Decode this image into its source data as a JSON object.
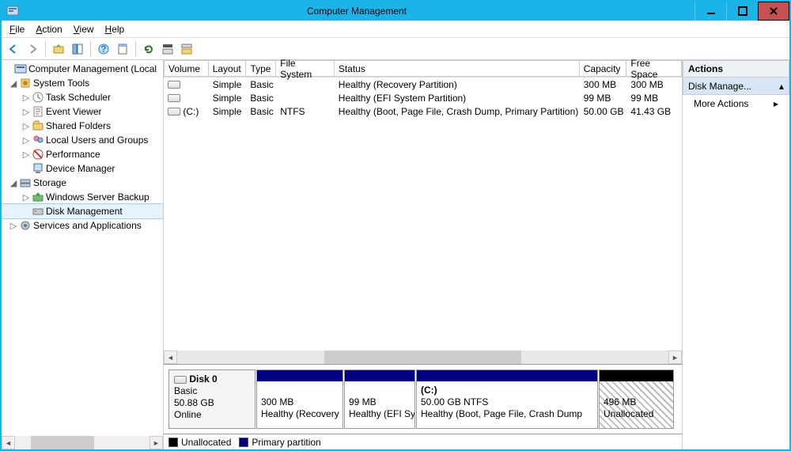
{
  "window": {
    "title": "Computer Management"
  },
  "menu": {
    "file": "File",
    "action": "Action",
    "view": "View",
    "help": "Help"
  },
  "tree": {
    "root": "Computer Management (Local",
    "systools": "System Tools",
    "tasksched": "Task Scheduler",
    "eventviewer": "Event Viewer",
    "sharedfolders": "Shared Folders",
    "localusers": "Local Users and Groups",
    "performance": "Performance",
    "devicemgr": "Device Manager",
    "storage": "Storage",
    "wsb": "Windows Server Backup",
    "diskmgmt": "Disk Management",
    "services": "Services and Applications"
  },
  "grid": {
    "headers": {
      "volume": "Volume",
      "layout": "Layout",
      "type": "Type",
      "fs": "File System",
      "status": "Status",
      "capacity": "Capacity",
      "free": "Free Space"
    },
    "rows": [
      {
        "vol": "",
        "layout": "Simple",
        "type": "Basic",
        "fs": "",
        "status": "Healthy (Recovery Partition)",
        "cap": "300 MB",
        "free": "300 MB"
      },
      {
        "vol": "",
        "layout": "Simple",
        "type": "Basic",
        "fs": "",
        "status": "Healthy (EFI System Partition)",
        "cap": "99 MB",
        "free": "99 MB"
      },
      {
        "vol": "(C:)",
        "layout": "Simple",
        "type": "Basic",
        "fs": "NTFS",
        "status": "Healthy (Boot, Page File, Crash Dump, Primary Partition)",
        "cap": "50.00 GB",
        "free": "41.43 GB"
      }
    ]
  },
  "disk0": {
    "name": "Disk 0",
    "type": "Basic",
    "size": "50.88 GB",
    "state": "Online",
    "parts": [
      {
        "label": "",
        "size": "300 MB",
        "status": "Healthy (Recovery"
      },
      {
        "label": "",
        "size": "99 MB",
        "status": "Healthy (EFI Sy"
      },
      {
        "label": "(C:)",
        "size": "50.00 GB NTFS",
        "status": "Healthy (Boot, Page File, Crash Dump"
      },
      {
        "label": "",
        "size": "496 MB",
        "status": "Unallocated"
      }
    ]
  },
  "legend": {
    "unalloc": "Unallocated",
    "primary": "Primary partition"
  },
  "actions": {
    "header": "Actions",
    "selected": "Disk Manage...",
    "more": "More Actions"
  }
}
